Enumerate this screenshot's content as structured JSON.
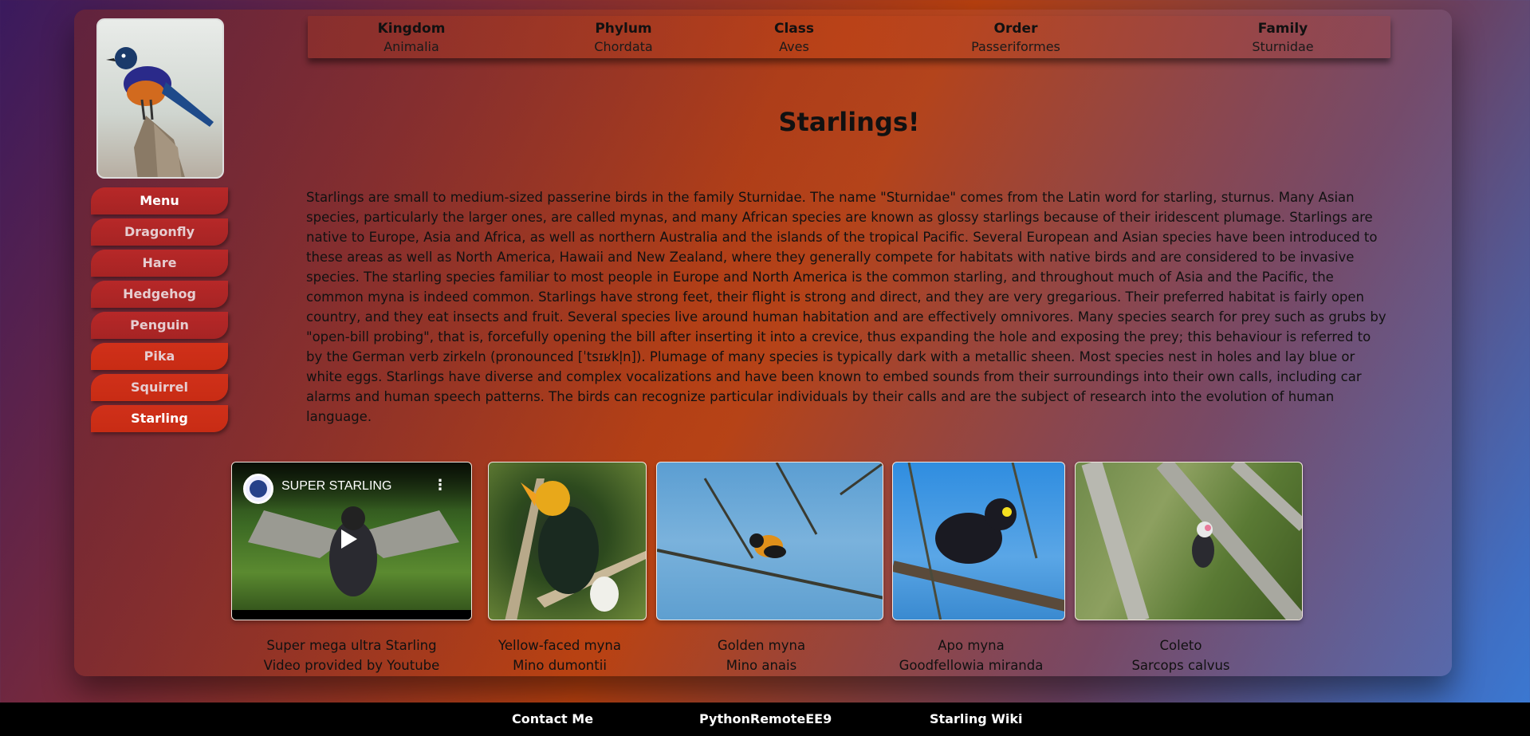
{
  "taxonomy": [
    {
      "key": "Kingdom",
      "value": "Animalia"
    },
    {
      "key": "Phylum",
      "value": "Chordata"
    },
    {
      "key": "Class",
      "value": "Aves"
    },
    {
      "key": "Order",
      "value": "Passeriformes"
    },
    {
      "key": "Family",
      "value": "Sturnidae"
    }
  ],
  "menu": {
    "items": [
      "Menu",
      "Dragonfly",
      "Hare",
      "Hedgehog",
      "Penguin",
      "Pika",
      "Squirrel",
      "Starling"
    ]
  },
  "main": {
    "title": "Starlings!",
    "description": "Starlings are small to medium-sized passerine birds in the family Sturnidae. The name \"Sturnidae\" comes from the Latin word for starling, sturnus. Many Asian species, particularly the larger ones, are called mynas, and many African species are known as glossy starlings because of their iridescent plumage. Starlings are native to Europe, Asia and Africa, as well as northern Australia and the islands of the tropical Pacific. Several European and Asian species have been introduced to these areas as well as North America, Hawaii and New Zealand, where they generally compete for habitats with native birds and are considered to be invasive species. The starling species familiar to most people in Europe and North America is the common starling, and throughout much of Asia and the Pacific, the common myna is indeed common. Starlings have strong feet, their flight is strong and direct, and they are very gregarious. Their preferred habitat is fairly open country, and they eat insects and fruit. Several species live around human habitation and are effectively omnivores. Many species search for prey such as grubs by \"open-bill probing\", that is, forcefully opening the bill after inserting it into a crevice, thus expanding the hole and exposing the prey; this behaviour is referred to by the German verb zirkeln (pronounced [ˈtsɪʁkl̩n]). Plumage of many species is typically dark with a metallic sheen. Most species nest in holes and lay blue or white eggs. Starlings have diverse and complex vocalizations and have been known to embed sounds from their surroundings into their own calls, including car alarms and human speech patterns. The birds can recognize particular individuals by their calls and are the subject of research into the evolution of human language."
  },
  "video": {
    "title": "SUPER STARLING",
    "menu_icon": "⋮"
  },
  "captions": [
    {
      "line1": "Super mega ultra Starling",
      "line2": "Video provided by Youtube"
    },
    {
      "line1": "Yellow-faced myna",
      "line2": "Mino dumontii"
    },
    {
      "line1": "Golden myna",
      "line2": "Mino anais"
    },
    {
      "line1": "Apo myna",
      "line2": "Goodfellowia miranda"
    },
    {
      "line1": "Coleto",
      "line2": "Sarcops calvus"
    }
  ],
  "footer": {
    "links": [
      "Contact Me",
      "PythonRemoteEE9",
      "Starling Wiki"
    ]
  },
  "colors": {
    "menu_button": "#b72828",
    "footer_bg": "#000000"
  }
}
